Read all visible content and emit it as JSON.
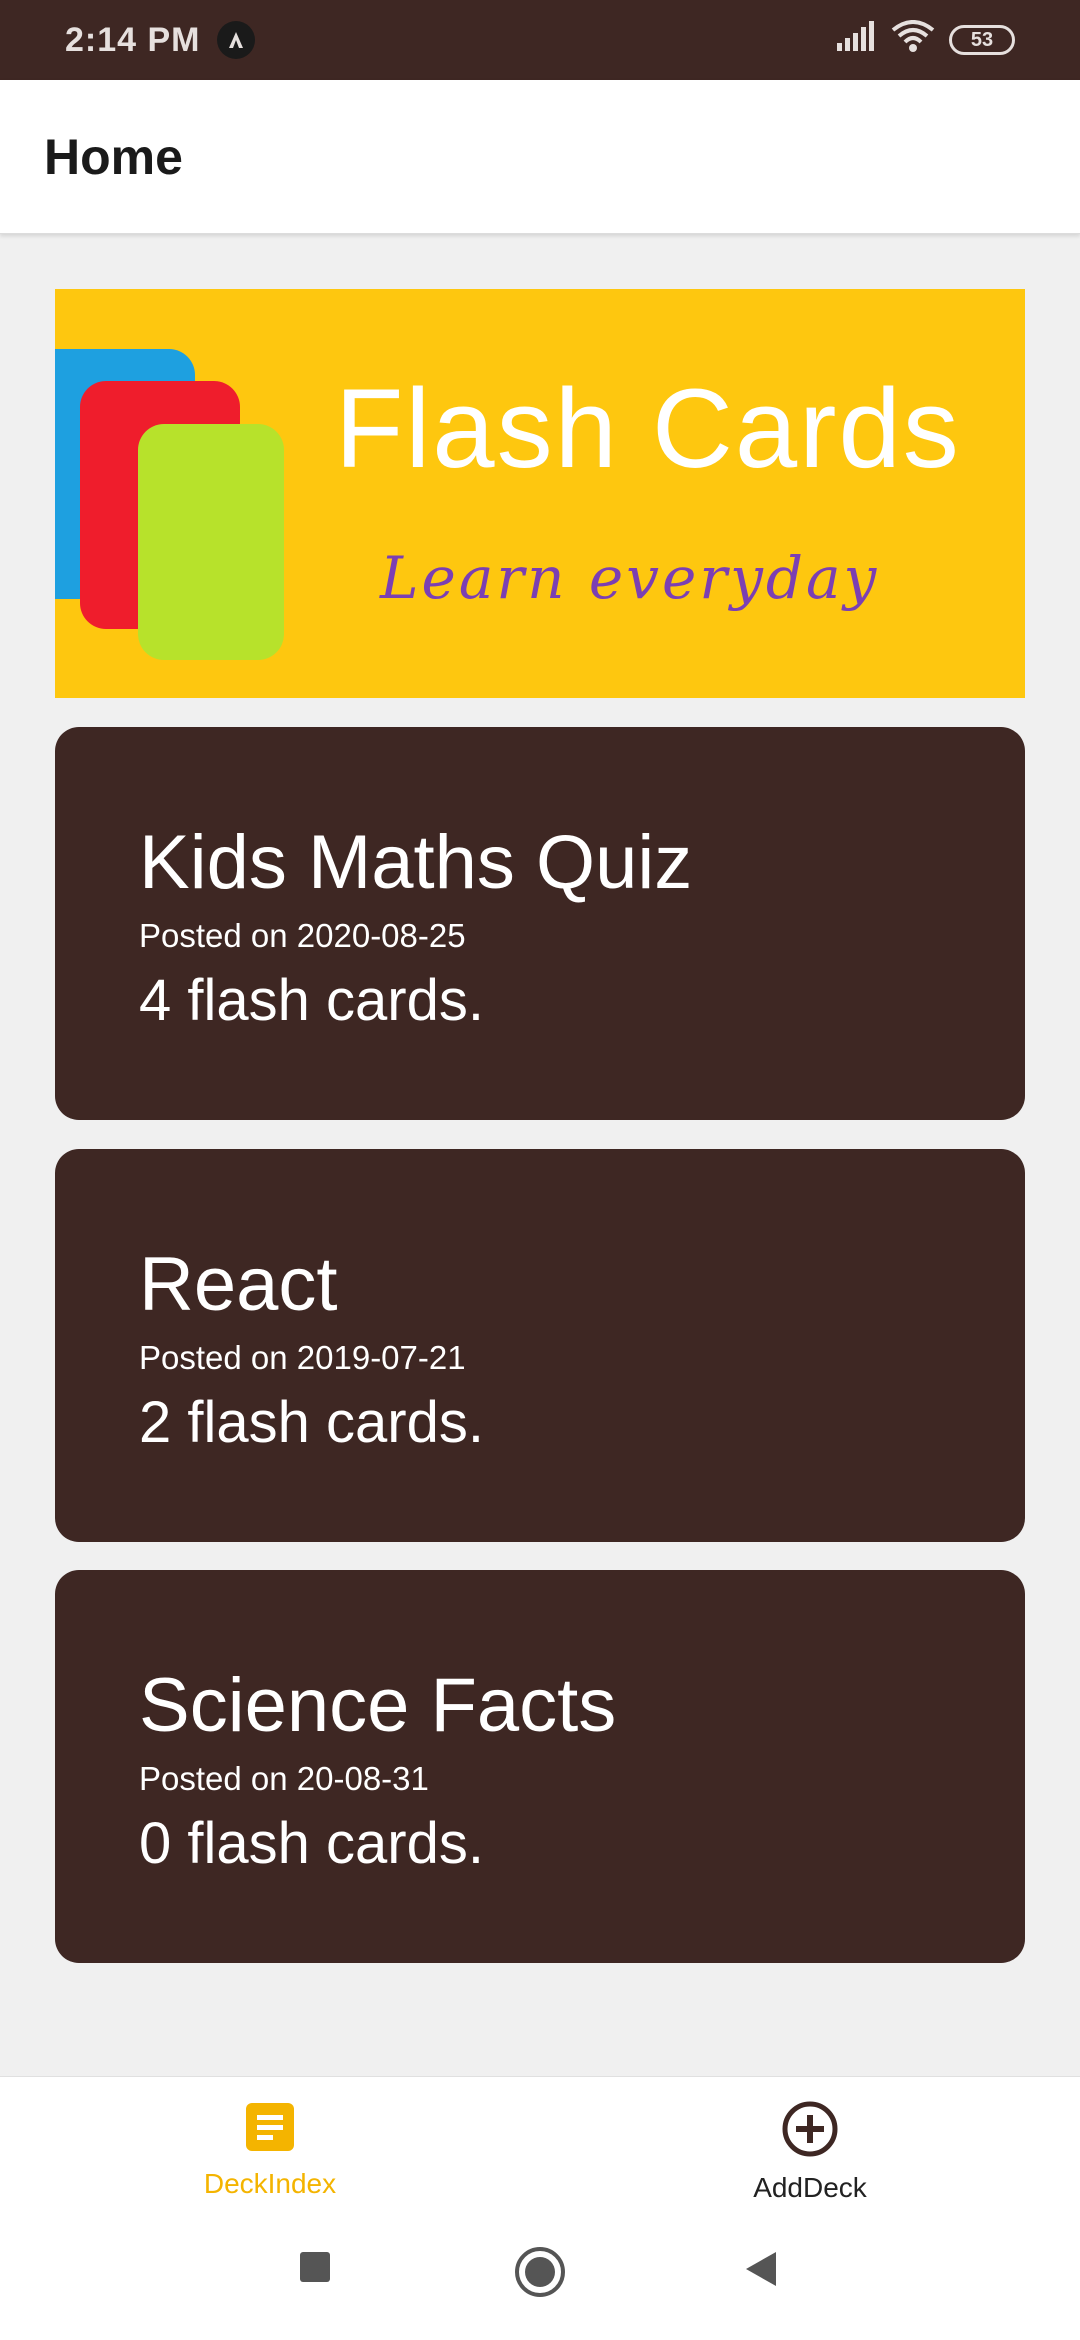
{
  "status_bar": {
    "time": "2:14 PM",
    "battery": "53",
    "icons": [
      "app-notification-icon",
      "signal-icon",
      "wifi-icon",
      "battery-icon"
    ]
  },
  "header": {
    "title": "Home"
  },
  "banner": {
    "title": "Flash Cards",
    "tagline": "Learn everyday"
  },
  "decks": [
    {
      "title": "Kids Maths Quiz",
      "date": "Posted on 2020-08-25",
      "count": "4 flash cards."
    },
    {
      "title": "React",
      "date": "Posted on 2019-07-21",
      "count": "2 flash cards."
    },
    {
      "title": "Science Facts",
      "date": "Posted on 20-08-31",
      "count": "0 flash cards."
    }
  ],
  "bottom_nav": {
    "items": [
      {
        "label": "DeckIndex",
        "icon": "document-icon",
        "active": true
      },
      {
        "label": "AddDeck",
        "icon": "add-circle-icon",
        "active": false
      }
    ]
  },
  "system_nav": {
    "icons": [
      "recents-icon",
      "home-icon",
      "back-icon"
    ]
  },
  "colors": {
    "primary": "#3e2723",
    "accent": "#f4b400",
    "banner": "#fec70f",
    "background": "#f0f0f0"
  }
}
